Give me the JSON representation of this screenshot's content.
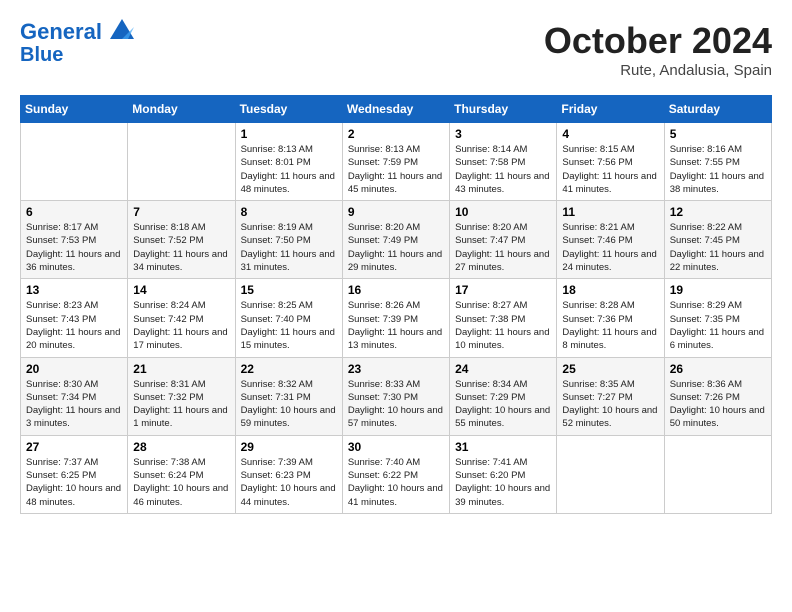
{
  "header": {
    "logo_line1": "General",
    "logo_line2": "Blue",
    "month": "October 2024",
    "location": "Rute, Andalusia, Spain"
  },
  "days_of_week": [
    "Sunday",
    "Monday",
    "Tuesday",
    "Wednesday",
    "Thursday",
    "Friday",
    "Saturday"
  ],
  "weeks": [
    [
      {
        "day": "",
        "info": ""
      },
      {
        "day": "",
        "info": ""
      },
      {
        "day": "1",
        "info": "Sunrise: 8:13 AM\nSunset: 8:01 PM\nDaylight: 11 hours and 48 minutes."
      },
      {
        "day": "2",
        "info": "Sunrise: 8:13 AM\nSunset: 7:59 PM\nDaylight: 11 hours and 45 minutes."
      },
      {
        "day": "3",
        "info": "Sunrise: 8:14 AM\nSunset: 7:58 PM\nDaylight: 11 hours and 43 minutes."
      },
      {
        "day": "4",
        "info": "Sunrise: 8:15 AM\nSunset: 7:56 PM\nDaylight: 11 hours and 41 minutes."
      },
      {
        "day": "5",
        "info": "Sunrise: 8:16 AM\nSunset: 7:55 PM\nDaylight: 11 hours and 38 minutes."
      }
    ],
    [
      {
        "day": "6",
        "info": "Sunrise: 8:17 AM\nSunset: 7:53 PM\nDaylight: 11 hours and 36 minutes."
      },
      {
        "day": "7",
        "info": "Sunrise: 8:18 AM\nSunset: 7:52 PM\nDaylight: 11 hours and 34 minutes."
      },
      {
        "day": "8",
        "info": "Sunrise: 8:19 AM\nSunset: 7:50 PM\nDaylight: 11 hours and 31 minutes."
      },
      {
        "day": "9",
        "info": "Sunrise: 8:20 AM\nSunset: 7:49 PM\nDaylight: 11 hours and 29 minutes."
      },
      {
        "day": "10",
        "info": "Sunrise: 8:20 AM\nSunset: 7:47 PM\nDaylight: 11 hours and 27 minutes."
      },
      {
        "day": "11",
        "info": "Sunrise: 8:21 AM\nSunset: 7:46 PM\nDaylight: 11 hours and 24 minutes."
      },
      {
        "day": "12",
        "info": "Sunrise: 8:22 AM\nSunset: 7:45 PM\nDaylight: 11 hours and 22 minutes."
      }
    ],
    [
      {
        "day": "13",
        "info": "Sunrise: 8:23 AM\nSunset: 7:43 PM\nDaylight: 11 hours and 20 minutes."
      },
      {
        "day": "14",
        "info": "Sunrise: 8:24 AM\nSunset: 7:42 PM\nDaylight: 11 hours and 17 minutes."
      },
      {
        "day": "15",
        "info": "Sunrise: 8:25 AM\nSunset: 7:40 PM\nDaylight: 11 hours and 15 minutes."
      },
      {
        "day": "16",
        "info": "Sunrise: 8:26 AM\nSunset: 7:39 PM\nDaylight: 11 hours and 13 minutes."
      },
      {
        "day": "17",
        "info": "Sunrise: 8:27 AM\nSunset: 7:38 PM\nDaylight: 11 hours and 10 minutes."
      },
      {
        "day": "18",
        "info": "Sunrise: 8:28 AM\nSunset: 7:36 PM\nDaylight: 11 hours and 8 minutes."
      },
      {
        "day": "19",
        "info": "Sunrise: 8:29 AM\nSunset: 7:35 PM\nDaylight: 11 hours and 6 minutes."
      }
    ],
    [
      {
        "day": "20",
        "info": "Sunrise: 8:30 AM\nSunset: 7:34 PM\nDaylight: 11 hours and 3 minutes."
      },
      {
        "day": "21",
        "info": "Sunrise: 8:31 AM\nSunset: 7:32 PM\nDaylight: 11 hours and 1 minute."
      },
      {
        "day": "22",
        "info": "Sunrise: 8:32 AM\nSunset: 7:31 PM\nDaylight: 10 hours and 59 minutes."
      },
      {
        "day": "23",
        "info": "Sunrise: 8:33 AM\nSunset: 7:30 PM\nDaylight: 10 hours and 57 minutes."
      },
      {
        "day": "24",
        "info": "Sunrise: 8:34 AM\nSunset: 7:29 PM\nDaylight: 10 hours and 55 minutes."
      },
      {
        "day": "25",
        "info": "Sunrise: 8:35 AM\nSunset: 7:27 PM\nDaylight: 10 hours and 52 minutes."
      },
      {
        "day": "26",
        "info": "Sunrise: 8:36 AM\nSunset: 7:26 PM\nDaylight: 10 hours and 50 minutes."
      }
    ],
    [
      {
        "day": "27",
        "info": "Sunrise: 7:37 AM\nSunset: 6:25 PM\nDaylight: 10 hours and 48 minutes."
      },
      {
        "day": "28",
        "info": "Sunrise: 7:38 AM\nSunset: 6:24 PM\nDaylight: 10 hours and 46 minutes."
      },
      {
        "day": "29",
        "info": "Sunrise: 7:39 AM\nSunset: 6:23 PM\nDaylight: 10 hours and 44 minutes."
      },
      {
        "day": "30",
        "info": "Sunrise: 7:40 AM\nSunset: 6:22 PM\nDaylight: 10 hours and 41 minutes."
      },
      {
        "day": "31",
        "info": "Sunrise: 7:41 AM\nSunset: 6:20 PM\nDaylight: 10 hours and 39 minutes."
      },
      {
        "day": "",
        "info": ""
      },
      {
        "day": "",
        "info": ""
      }
    ]
  ]
}
